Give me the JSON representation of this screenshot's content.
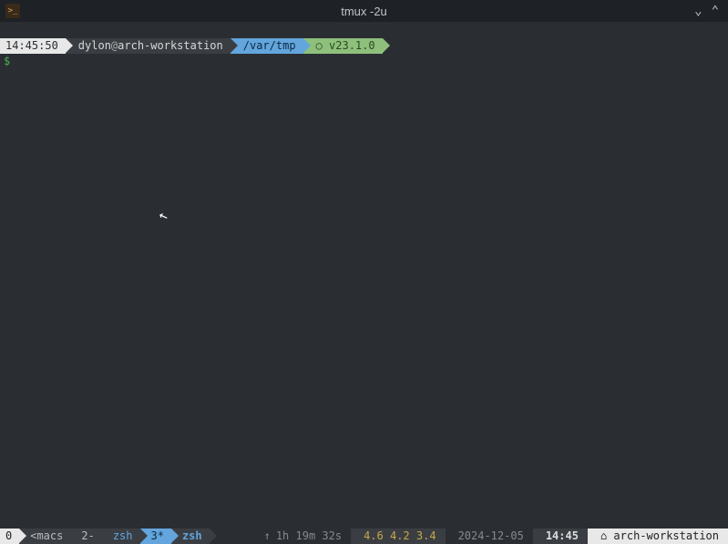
{
  "titlebar": {
    "title": "tmux -2u"
  },
  "prompt": {
    "time": "14:45:50",
    "user": "dylon",
    "host": "arch-workstation",
    "path": "/var/tmp",
    "version_glyph": "○",
    "version": "v23.1.0",
    "dollar": "$"
  },
  "status": {
    "session": "0",
    "win1": {
      "label": "<macs",
      "idx": "2-",
      "name": "zsh"
    },
    "win2": {
      "idx": "3*",
      "name": "zsh"
    },
    "uptime_arrow": "↑",
    "uptime": "1h 19m 32s",
    "load": "4.6 4.2 3.4",
    "date": "2024-12-05",
    "time": "14:45",
    "host_glyph": "⌂",
    "host": "arch-workstation"
  }
}
